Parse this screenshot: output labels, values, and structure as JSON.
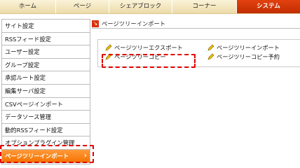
{
  "nav": {
    "tabs": [
      {
        "label": "ホーム"
      },
      {
        "label": "ページ"
      },
      {
        "label": "シェアブロック"
      },
      {
        "label": "コーナー"
      },
      {
        "label": "システム"
      }
    ]
  },
  "sidebar": {
    "items": [
      {
        "label": "サイト設定"
      },
      {
        "label": "RSSフィード設定"
      },
      {
        "label": "ユーザー設定"
      },
      {
        "label": "グループ設定"
      },
      {
        "label": "承認ルート設定"
      },
      {
        "label": "編集サーバ設定"
      },
      {
        "label": "CSVページインポート"
      },
      {
        "label": "データソース管理"
      },
      {
        "label": "動的RSSフィード設定"
      },
      {
        "label": "オプションプラグイン管理"
      },
      {
        "label": "ページツリーインポート"
      }
    ]
  },
  "main": {
    "breadcrumb": "ページツリーインポート",
    "links": [
      {
        "label": "ページツリーエクスポート"
      },
      {
        "label": "ページツリーコピー"
      },
      {
        "label": "ページツリーインポート"
      },
      {
        "label": "ページツリーコピー予約"
      }
    ]
  },
  "colors": {
    "active_tab": "#d9300b",
    "active_side": "#f57300",
    "highlight": "#e00000"
  }
}
